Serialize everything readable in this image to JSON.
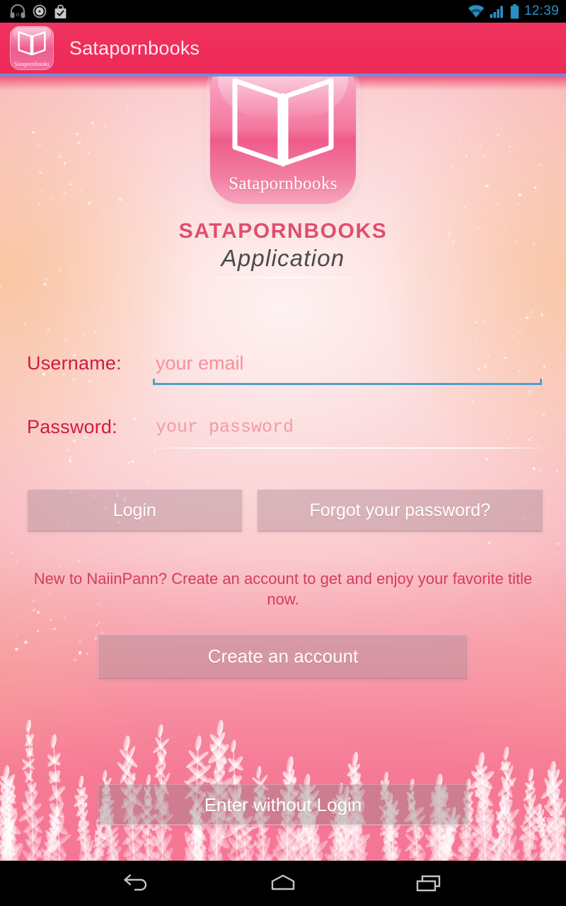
{
  "status_bar": {
    "time": "12:39",
    "left_icons": [
      "headphones-icon",
      "clock-icon",
      "play-store-bag-icon"
    ],
    "right_icons": [
      "wifi-icon",
      "cellular-signal-icon",
      "battery-icon"
    ],
    "time_color": "#2a8fc4"
  },
  "action_bar": {
    "title": "Satapornbooks",
    "logo_word": "Satapornbooks",
    "background_color": "#ef2e5b",
    "accent_line_color": "#6f8ede"
  },
  "hero": {
    "logo_word": "Satapornbooks",
    "brand_line1": "SATAPORNBOOKS",
    "brand_line2": "Application",
    "brand_line1_color": "#e04f6d",
    "brand_line2_color": "#4a4a4a"
  },
  "form": {
    "username": {
      "label": "Username:",
      "placeholder": "your email",
      "value": "",
      "focused": true,
      "underline_color": "#4f9fd0"
    },
    "password": {
      "label": "Password:",
      "placeholder": "your password",
      "value": "",
      "focused": false,
      "underline_color": "#ffffff"
    }
  },
  "buttons": {
    "login": "Login",
    "forgot_password": "Forgot your password?",
    "create_account": "Create an account",
    "enter_without_login": "Enter without Login"
  },
  "promo": {
    "text": "New to NaiinPann? Create an account to get and enjoy your favorite title now.",
    "color": "#d63a5f"
  },
  "nav_bar": {
    "items": [
      "back-icon",
      "home-icon",
      "recents-icon"
    ]
  },
  "theme": {
    "primary_pink": "#ef2e5b",
    "background_pink": "#f7a7b2",
    "label_crimson": "#cf1b46",
    "placeholder_pink": "#f5909e"
  }
}
